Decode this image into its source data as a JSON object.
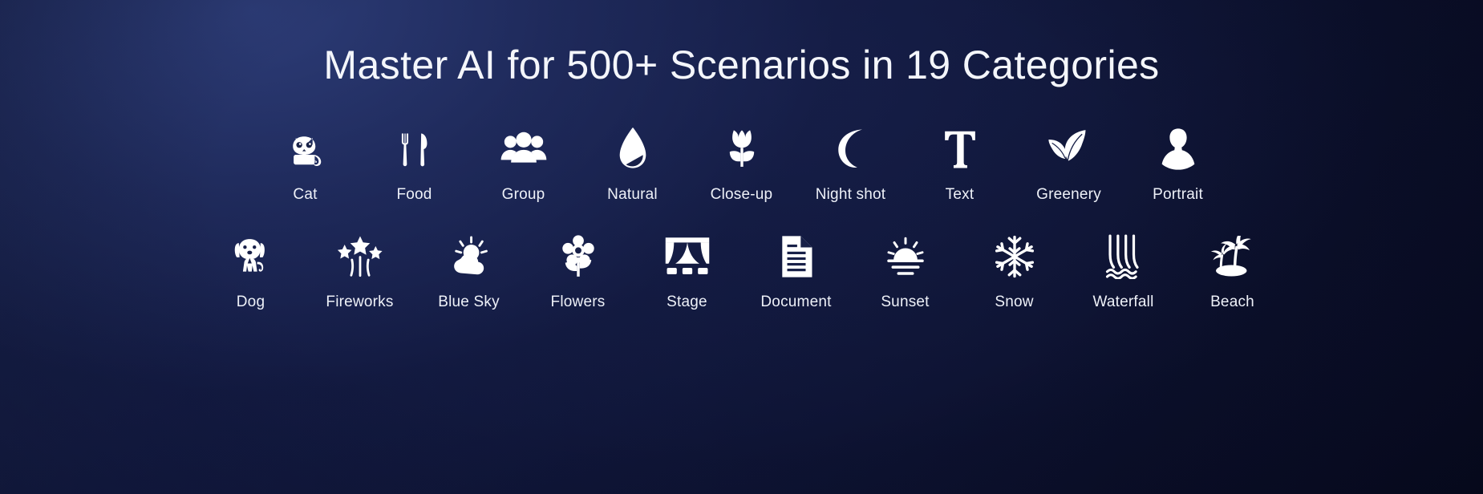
{
  "header": {
    "title": "Master AI for 500+ Scenarios in 19 Categories"
  },
  "theme": {
    "background_top_left": "#1e2a5c",
    "background_bottom_right": "#0a0e28",
    "icon_color": "#ffffff",
    "title_color": "#f4f6fb",
    "label_color": "#eef1f8"
  },
  "scenarios": {
    "total_categories": 19,
    "row1": [
      {
        "label": "Cat",
        "icon": "cat-icon"
      },
      {
        "label": "Food",
        "icon": "fork-knife-icon"
      },
      {
        "label": "Group",
        "icon": "people-group-icon"
      },
      {
        "label": "Natural",
        "icon": "water-drop-icon"
      },
      {
        "label": "Close-up",
        "icon": "tulip-icon"
      },
      {
        "label": "Night shot",
        "icon": "crescent-moon-icon"
      },
      {
        "label": "Text",
        "icon": "letter-t-icon"
      },
      {
        "label": "Greenery",
        "icon": "leaves-icon"
      },
      {
        "label": "Portrait",
        "icon": "person-bust-icon"
      }
    ],
    "row2": [
      {
        "label": "Dog",
        "icon": "dog-icon"
      },
      {
        "label": "Fireworks",
        "icon": "fireworks-stars-icon"
      },
      {
        "label": "Blue Sky",
        "icon": "sun-cloud-icon"
      },
      {
        "label": "Flowers",
        "icon": "flower-icon"
      },
      {
        "label": "Stage",
        "icon": "stage-curtains-icon"
      },
      {
        "label": "Document",
        "icon": "document-page-icon"
      },
      {
        "label": "Sunset",
        "icon": "sunset-icon"
      },
      {
        "label": "Snow",
        "icon": "snowflake-icon"
      },
      {
        "label": "Waterfall",
        "icon": "waterfall-icon"
      },
      {
        "label": "Beach",
        "icon": "palm-island-icon"
      }
    ]
  }
}
